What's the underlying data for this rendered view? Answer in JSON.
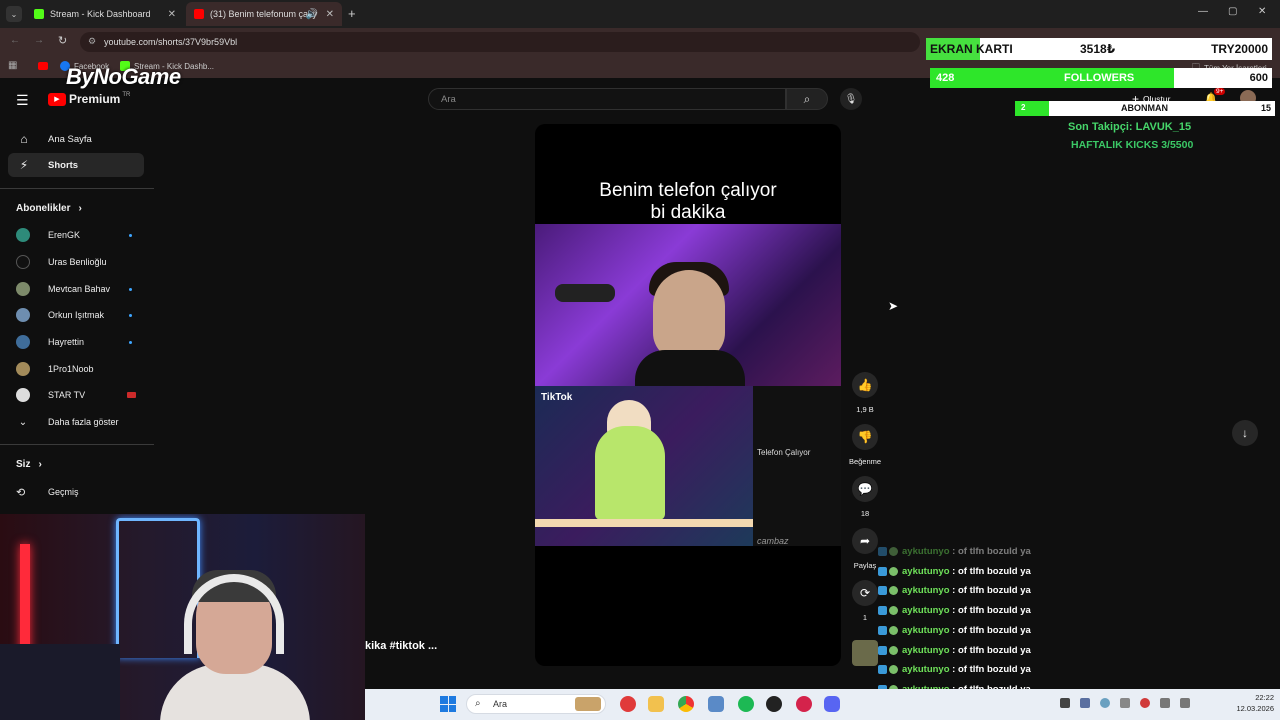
{
  "browser": {
    "tabs": [
      {
        "title": "Stream - Kick Dashboard"
      },
      {
        "title": "(31) Benim telefonum çalıy"
      }
    ],
    "url": "youtube.com/shorts/37V9br59Vbl",
    "bookmarks": [
      "Facebook",
      "Stream - Kick Dashb...",
      "Tüm Yer İşaretleri"
    ]
  },
  "youtube": {
    "logo": "Premium",
    "logo_region": "TR",
    "search_placeholder": "Ara",
    "create_label": "Oluştur",
    "notif_badge": "9+",
    "nav": [
      {
        "label": "Ana Sayfa",
        "icon": "home-icon"
      },
      {
        "label": "Shorts",
        "icon": "shorts-icon"
      }
    ],
    "subscriptions_header": "Abonelikler",
    "subscriptions": [
      {
        "name": "ErenGK",
        "dot": true
      },
      {
        "name": "Uras Benlioğlu",
        "dot": false
      },
      {
        "name": "Mevtcan Bahav",
        "dot": true
      },
      {
        "name": "Orkun Işıtmak",
        "dot": true
      },
      {
        "name": "Hayrettin",
        "dot": true
      },
      {
        "name": "1Pro1Noob",
        "dot": false
      },
      {
        "name": "STAR TV",
        "dot": false
      }
    ],
    "show_more": "Daha fazla göster",
    "you_header": "Siz",
    "history": "Geçmiş",
    "short": {
      "title_line1": "Benim telefon çalıyor",
      "title_line2": "bi dakika",
      "tiktok_label": "TikTok",
      "side_title": "Telefon Çalıyor",
      "watermark": "cambaz",
      "caption": "kika #tiktok ..."
    },
    "actions": {
      "likes": "1,9 B",
      "dislike": "Beğenme",
      "comments": "18",
      "share": "Paylaş",
      "remix": "1"
    }
  },
  "overlay": {
    "ekran_label": "EKRAN KARTI",
    "ekran_value": "3518₺",
    "ekran_goal": "TRY20000",
    "followers_current": "428",
    "followers_label": "FOLLOWERS",
    "followers_goal": "600",
    "followers_progress": 0.713,
    "abone_current": "2",
    "abone_label": "ABONMAN",
    "abone_goal": "15",
    "abone_progress": 0.13,
    "last_follower": "Son Takipçi: LAVUK_15",
    "weekly_kicks": "HAFTALIK KICKS 3/5500"
  },
  "chat": [
    {
      "user": "aykutunyo",
      "msg": ": of tlfn bozuld ya",
      "faded": true
    },
    {
      "user": "aykutunyo",
      "msg": ": of tlfn bozuld ya"
    },
    {
      "user": "aykutunyo",
      "msg": ": of tlfn bozuld ya"
    },
    {
      "user": "aykutunyo",
      "msg": ": of tlfn bozuld ya"
    },
    {
      "user": "aykutunyo",
      "msg": ": of tlfn bozuld ya"
    },
    {
      "user": "aykutunyo",
      "msg": ": of tlfn bozuld ya"
    },
    {
      "user": "aykutunyo",
      "msg": ": of tlfn bozuld ya"
    },
    {
      "user": "aykutunyo",
      "msg": ": of tlfn bozuld ya"
    },
    {
      "user": "aykutunyo",
      "msg": ": of tlfn bozuld ya"
    }
  ],
  "taskbar": {
    "search": "Ara",
    "time": "22:22",
    "date": "12.03.2026"
  },
  "brand_overlay": "ByNoGame"
}
